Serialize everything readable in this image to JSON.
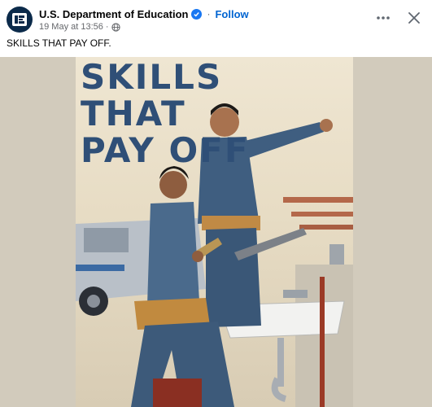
{
  "post": {
    "author": "U.S. Department of Education",
    "follow_label": "Follow",
    "timestamp": "19 May at 13:56",
    "separator": "·",
    "caption": "SKILLS THAT PAY OFF."
  },
  "icons": {
    "avatar": "ed-logo-icon",
    "verified": "verified-badge-icon",
    "audience": "globe-icon",
    "more": "more-options-icon",
    "close": "close-icon"
  },
  "poster": {
    "title": "SKILLS THAT\nPAY OFF"
  },
  "colors": {
    "follow": "#0064d1",
    "verified": "#1877f2",
    "poster_title": "#2f4f77",
    "media_background": "#d2cbbc"
  }
}
